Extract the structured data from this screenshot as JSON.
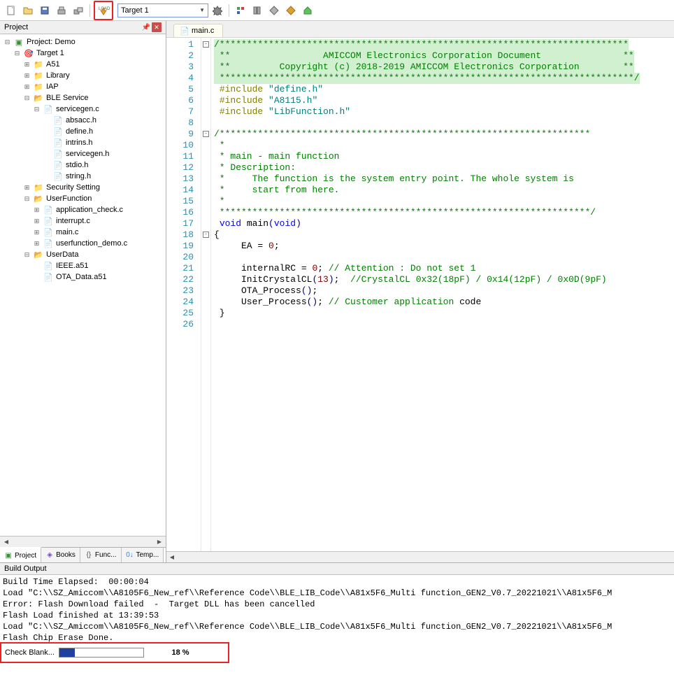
{
  "toolbar": {
    "target_value": "Target 1"
  },
  "project_panel": {
    "title": "Project",
    "tree": {
      "root": "Project: Demo",
      "target": "Target 1",
      "folders": {
        "a51": "A51",
        "library": "Library",
        "iap": "IAP",
        "ble_service": "BLE Service",
        "security_setting": "Security Setting",
        "user_function": "UserFunction",
        "user_data": "UserData"
      },
      "files": {
        "servicegen_c": "servicegen.c",
        "absacc_h": "absacc.h",
        "define_h": "define.h",
        "intrins_h": "intrins.h",
        "servicegen_h": "servicegen.h",
        "stdio_h": "stdio.h",
        "string_h": "string.h",
        "application_check_c": "application_check.c",
        "interrupt_c": "interrupt.c",
        "main_c": "main.c",
        "userfunction_demo_c": "userfunction_demo.c",
        "ieee_a51": "IEEE.a51",
        "ota_data_a51": "OTA_Data.a51"
      }
    },
    "tabs": {
      "project": "Project",
      "books": "Books",
      "functions": "Func...",
      "templates": "Temp..."
    }
  },
  "editor": {
    "tab_name": "main.c",
    "code_lines": [
      "/***************************************************************************",
      " **                 AMICCOM Electronics Corporation Document               **",
      " **         Copyright (c) 2018-2019 AMICCOM Electronics Corporation        **",
      " ****************************************************************************/",
      " #include \"define.h\"",
      " #include \"A8115.h\"",
      " #include \"LibFunction.h\"",
      "",
      "/********************************************************************",
      " *",
      " * main - main function",
      " * Description:",
      " *     The function is the system entry point. The whole system is",
      " *     start from here.",
      " *",
      " ********************************************************************/",
      " void main(void)",
      "{",
      "     EA = 0;",
      "",
      "     internalRC = 0; // Attention : Do not set 1",
      "     InitCrystalCL(13);  //CrystalCL 0x32(18pF) / 0x14(12pF) / 0x0D(9pF)",
      "     OTA_Process();",
      "     User_Process(); // Customer application code",
      " }",
      ""
    ]
  },
  "build_output": {
    "title": "Build Output",
    "lines": [
      "Build Time Elapsed:  00:00:04",
      "Load \"C:\\\\SZ_Amiccom\\\\A8105F6_New_ref\\\\Reference Code\\\\BLE_LIB_Code\\\\A81x5F6_Multi function_GEN2_V0.7_20221021\\\\A81x5F6_M",
      "Error: Flash Download failed  -  Target DLL has been cancelled",
      "Flash Load finished at 13:39:53",
      "Load \"C:\\\\SZ_Amiccom\\\\A8105F6_New_ref\\\\Reference Code\\\\BLE_LIB_Code\\\\A81x5F6_Multi function_GEN2_V0.7_20221021\\\\A81x5F6_M",
      "Flash Chip Erase Done."
    ]
  },
  "progress": {
    "label": "Check Blank...",
    "percent_text": "18 %",
    "percent_value": 18
  }
}
